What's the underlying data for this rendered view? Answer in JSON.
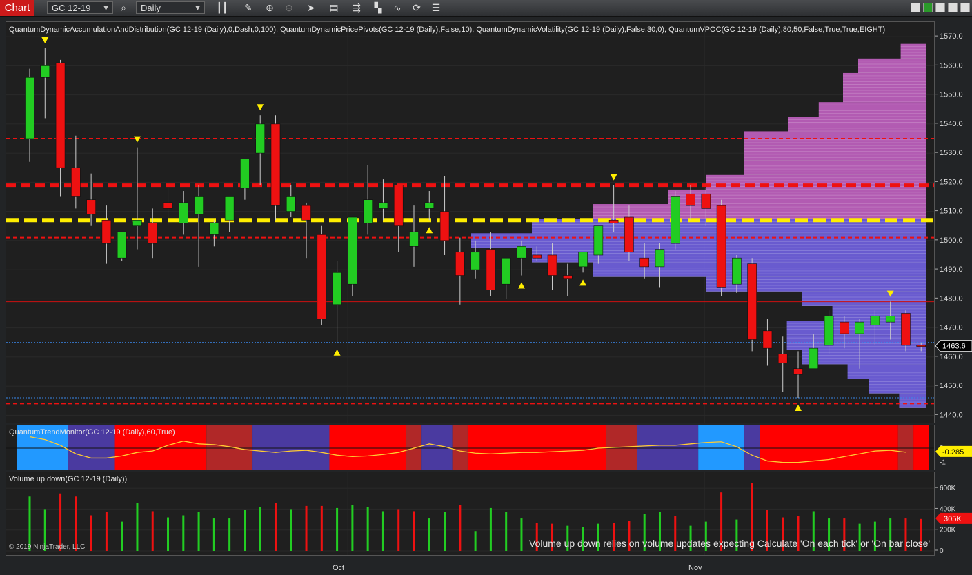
{
  "toolbar": {
    "chart_tab": "Chart",
    "instrument": "GC 12-19",
    "timeframe": "Daily",
    "icons": [
      "search-icon",
      "bars-icon",
      "pencil-icon",
      "zoom-in-icon",
      "zoom-out-icon",
      "pointer-icon",
      "data-box-icon",
      "strategy-icon",
      "drawing-tools-icon",
      "indicators-icon",
      "reload-icon",
      "properties-icon"
    ]
  },
  "price_panel": {
    "indicator_label": "QuantumDynamicAccumulationAndDistribution(GC 12-19 (Daily),0,Dash,0,100), QuantumDynamicPricePivots(GC 12-19 (Daily),False,10), QuantumDynamicVolatility(GC 12-19 (Daily),False,30,0), QuantumVPOC(GC 12-19 (Daily),80,50,False,True,True,EIGHT)",
    "axis_ticks": [
      "1570.0",
      "1560.0",
      "1550.0",
      "1540.0",
      "1530.0",
      "1520.0",
      "1510.0",
      "1500.0",
      "1490.0",
      "1480.0",
      "1470.0",
      "1460.0",
      "1450.0",
      "1440.0"
    ],
    "last_price": "1463.6"
  },
  "trend_panel": {
    "label": "QuantumTrendMonitor(GC 12-19 (Daily),60,True)",
    "axis_ticks": [
      "0",
      "-1"
    ],
    "value": "-0.285"
  },
  "volume_panel": {
    "label": "Volume up down(GC 12-19 (Daily))",
    "axis_ticks": [
      "600K",
      "400K",
      "200K",
      "0"
    ],
    "value": "305K",
    "note": "Volume up down relies on volume updates expecting Calculate 'On each tick' or 'On bar close'",
    "copyright": "© 2019 NinjaTrader, LLC"
  },
  "time_axis": {
    "labels": [
      "Oct",
      "Nov"
    ]
  },
  "colors": {
    "up": "#22cc22",
    "down": "#ee1111",
    "pivot": "#ffee00",
    "vpoc": "#ffee00",
    "volume_profile": "#7766ee",
    "volume_profile_upper": "#cc66cc"
  },
  "chart_data": {
    "type": "candlestick",
    "ylim": [
      1437,
      1575
    ],
    "levels": [
      {
        "price": 1535,
        "style": "dash-red"
      },
      {
        "price": 1519,
        "style": "dash-red-thick"
      },
      {
        "price": 1507,
        "style": "dash-yellow-thick"
      },
      {
        "price": 1501,
        "style": "dash-red"
      },
      {
        "price": 1479,
        "style": "thin-red"
      },
      {
        "price": 1465,
        "style": "thin-blue"
      },
      {
        "price": 1446,
        "style": "thin-blue"
      },
      {
        "price": 1444,
        "style": "dash-red"
      }
    ],
    "candles": [
      {
        "o": 1535,
        "h": 1559,
        "l": 1527,
        "c": 1556
      },
      {
        "o": 1556,
        "h": 1566,
        "l": 1542,
        "c": 1560
      },
      {
        "o": 1561,
        "h": 1562,
        "l": 1515,
        "c": 1525
      },
      {
        "o": 1525,
        "h": 1536,
        "l": 1511,
        "c": 1515
      },
      {
        "o": 1514,
        "h": 1523,
        "l": 1505,
        "c": 1509
      },
      {
        "o": 1507,
        "h": 1512,
        "l": 1492,
        "c": 1499
      },
      {
        "o": 1494,
        "h": 1503,
        "l": 1493,
        "c": 1503
      },
      {
        "o": 1505,
        "h": 1532,
        "l": 1497,
        "c": 1507
      },
      {
        "o": 1506,
        "h": 1511,
        "l": 1494,
        "c": 1499
      },
      {
        "o": 1513,
        "h": 1518,
        "l": 1505,
        "c": 1511
      },
      {
        "o": 1506,
        "h": 1517,
        "l": 1502,
        "c": 1513
      },
      {
        "o": 1509,
        "h": 1519,
        "l": 1491,
        "c": 1515
      },
      {
        "o": 1502,
        "h": 1507,
        "l": 1498,
        "c": 1506
      },
      {
        "o": 1507,
        "h": 1515,
        "l": 1503,
        "c": 1515
      },
      {
        "o": 1518,
        "h": 1521,
        "l": 1514,
        "c": 1528
      },
      {
        "o": 1530,
        "h": 1543,
        "l": 1519,
        "c": 1540
      },
      {
        "o": 1540,
        "h": 1543,
        "l": 1507,
        "c": 1512
      },
      {
        "o": 1510,
        "h": 1519,
        "l": 1508,
        "c": 1515
      },
      {
        "o": 1512,
        "h": 1513,
        "l": 1494,
        "c": 1507
      },
      {
        "o": 1502,
        "h": 1505,
        "l": 1471,
        "c": 1473
      },
      {
        "o": 1478,
        "h": 1493,
        "l": 1465,
        "c": 1489
      },
      {
        "o": 1485,
        "h": 1508,
        "l": 1481,
        "c": 1508
      },
      {
        "o": 1506,
        "h": 1526,
        "l": 1502,
        "c": 1514
      },
      {
        "o": 1511,
        "h": 1521,
        "l": 1507,
        "c": 1513
      },
      {
        "o": 1519,
        "h": 1519,
        "l": 1496,
        "c": 1505
      },
      {
        "o": 1498,
        "h": 1512,
        "l": 1491,
        "c": 1503
      },
      {
        "o": 1511,
        "h": 1517,
        "l": 1507,
        "c": 1513
      },
      {
        "o": 1510,
        "h": 1522,
        "l": 1495,
        "c": 1500
      },
      {
        "o": 1496,
        "h": 1501,
        "l": 1478,
        "c": 1488
      },
      {
        "o": 1490,
        "h": 1500,
        "l": 1487,
        "c": 1496
      },
      {
        "o": 1497,
        "h": 1503,
        "l": 1481,
        "c": 1483
      },
      {
        "o": 1485,
        "h": 1494,
        "l": 1480,
        "c": 1494
      },
      {
        "o": 1494,
        "h": 1500,
        "l": 1488,
        "c": 1498
      },
      {
        "o": 1495,
        "h": 1498,
        "l": 1493,
        "c": 1494
      },
      {
        "o": 1495,
        "h": 1499,
        "l": 1483,
        "c": 1488
      },
      {
        "o": 1488,
        "h": 1492,
        "l": 1481,
        "c": 1487
      },
      {
        "o": 1491,
        "h": 1496,
        "l": 1489,
        "c": 1496
      },
      {
        "o": 1495,
        "h": 1501,
        "l": 1492,
        "c": 1505
      },
      {
        "o": 1507,
        "h": 1519,
        "l": 1503,
        "c": 1506
      },
      {
        "o": 1508,
        "h": 1512,
        "l": 1493,
        "c": 1496
      },
      {
        "o": 1494,
        "h": 1499,
        "l": 1487,
        "c": 1491
      },
      {
        "o": 1491,
        "h": 1499,
        "l": 1484,
        "c": 1497
      },
      {
        "o": 1499,
        "h": 1517,
        "l": 1497,
        "c": 1515
      },
      {
        "o": 1516,
        "h": 1519,
        "l": 1507,
        "c": 1512
      },
      {
        "o": 1516,
        "h": 1518,
        "l": 1505,
        "c": 1511
      },
      {
        "o": 1512,
        "h": 1514,
        "l": 1481,
        "c": 1484
      },
      {
        "o": 1485,
        "h": 1495,
        "l": 1482,
        "c": 1494
      },
      {
        "o": 1492,
        "h": 1494,
        "l": 1462,
        "c": 1466
      },
      {
        "o": 1469,
        "h": 1473,
        "l": 1457,
        "c": 1463
      },
      {
        "o": 1461,
        "h": 1467,
        "l": 1448,
        "c": 1458
      },
      {
        "o": 1456,
        "h": 1462,
        "l": 1446,
        "c": 1454
      },
      {
        "o": 1456,
        "h": 1468,
        "l": 1456,
        "c": 1463
      },
      {
        "o": 1464,
        "h": 1476,
        "l": 1461,
        "c": 1474
      },
      {
        "o": 1472,
        "h": 1474,
        "l": 1463,
        "c": 1468
      },
      {
        "o": 1468,
        "h": 1473,
        "l": 1456,
        "c": 1472
      },
      {
        "o": 1471,
        "h": 1476,
        "l": 1464,
        "c": 1474
      },
      {
        "o": 1472,
        "h": 1479,
        "l": 1466,
        "c": 1474
      },
      {
        "o": 1475,
        "h": 1476,
        "l": 1462,
        "c": 1464
      },
      {
        "o": 1464,
        "h": 1465,
        "l": 1462,
        "c": 1463.6
      }
    ],
    "markers": [
      {
        "i": 1,
        "type": "down"
      },
      {
        "i": 7,
        "type": "down"
      },
      {
        "i": 15,
        "type": "down"
      },
      {
        "i": 20,
        "type": "up"
      },
      {
        "i": 26,
        "type": "up"
      },
      {
        "i": 32,
        "type": "up"
      },
      {
        "i": 36,
        "type": "up"
      },
      {
        "i": 38,
        "type": "down"
      },
      {
        "i": 50,
        "type": "up"
      },
      {
        "i": 56,
        "type": "down"
      }
    ],
    "volume_profile": [
      {
        "price": 1565,
        "size": 0.17
      },
      {
        "price": 1560,
        "size": 0.45
      },
      {
        "price": 1555,
        "size": 0.55
      },
      {
        "price": 1550,
        "size": 0.55
      },
      {
        "price": 1545,
        "size": 0.71
      },
      {
        "price": 1540,
        "size": 0.91
      },
      {
        "price": 1535,
        "size": 1.2
      },
      {
        "price": 1530,
        "size": 1.2
      },
      {
        "price": 1525,
        "size": 1.2
      },
      {
        "price": 1520,
        "size": 1.45
      },
      {
        "price": 1515,
        "size": 1.7
      },
      {
        "price": 1510,
        "size": 2.2
      },
      {
        "price": 1505,
        "size": 2.6
      },
      {
        "price": 1500,
        "size": 3.0
      },
      {
        "price": 1495,
        "size": 2.6
      },
      {
        "price": 1490,
        "size": 2.2
      },
      {
        "price": 1485,
        "size": 1.45
      },
      {
        "price": 1480,
        "size": 0.82
      },
      {
        "price": 1475,
        "size": 0.62
      },
      {
        "price": 1470,
        "size": 0.92
      },
      {
        "price": 1465,
        "size": 0.92
      },
      {
        "price": 1460,
        "size": 0.82
      },
      {
        "price": 1455,
        "size": 0.52
      },
      {
        "price": 1450,
        "size": 0.38
      },
      {
        "price": 1445,
        "size": 0.18
      }
    ],
    "trend_segments": [
      {
        "from": 0,
        "to": 3,
        "color": "#2299ff"
      },
      {
        "from": 3,
        "to": 6,
        "color": "#4a3aa0"
      },
      {
        "from": 6,
        "to": 12,
        "color": "#ff0000"
      },
      {
        "from": 12,
        "to": 15,
        "color": "#b02828"
      },
      {
        "from": 15,
        "to": 20,
        "color": "#4a3aa0"
      },
      {
        "from": 20,
        "to": 25,
        "color": "#ff0000"
      },
      {
        "from": 25,
        "to": 26,
        "color": "#b02828"
      },
      {
        "from": 26,
        "to": 28,
        "color": "#4a3aa0"
      },
      {
        "from": 28,
        "to": 29,
        "color": "#b02828"
      },
      {
        "from": 29,
        "to": 38,
        "color": "#ff0000"
      },
      {
        "from": 38,
        "to": 40,
        "color": "#b02828"
      },
      {
        "from": 40,
        "to": 44,
        "color": "#4a3aa0"
      },
      {
        "from": 44,
        "to": 47,
        "color": "#2299ff"
      },
      {
        "from": 47,
        "to": 48,
        "color": "#4a3aa0"
      },
      {
        "from": 48,
        "to": 57,
        "color": "#ff0000"
      },
      {
        "from": 57,
        "to": 58,
        "color": "#b02828"
      },
      {
        "from": 58,
        "to": 59,
        "color": "#ff0000"
      }
    ],
    "trend_line": [
      0.8,
      0.6,
      0.2,
      -0.4,
      -0.7,
      -0.7,
      -0.55,
      -0.3,
      -0.2,
      0.2,
      0.5,
      0.3,
      0.25,
      0.1,
      -0.1,
      -0.2,
      -0.3,
      -0.2,
      -0.15,
      -0.3,
      -0.5,
      -0.6,
      -0.55,
      -0.45,
      -0.3,
      0.0,
      0.3,
      0.1,
      -0.2,
      -0.35,
      -0.4,
      -0.35,
      -0.3,
      -0.3,
      -0.25,
      -0.2,
      -0.15,
      0.0,
      0.05,
      0.1,
      0.15,
      0.2,
      0.2,
      0.3,
      0.4,
      0.45,
      0.1,
      -0.5,
      -0.9,
      -1.0,
      -1.0,
      -0.9,
      -0.8,
      -0.6,
      -0.4,
      -0.2,
      -0.15,
      -0.285
    ],
    "volume": [
      520,
      400,
      550,
      520,
      340,
      370,
      280,
      460,
      380,
      320,
      340,
      370,
      310,
      310,
      390,
      420,
      460,
      400,
      430,
      430,
      410,
      440,
      420,
      380,
      400,
      380,
      310,
      370,
      440,
      190,
      410,
      370,
      310,
      270,
      260,
      240,
      230,
      260,
      270,
      290,
      350,
      370,
      330,
      240,
      280,
      560,
      300,
      650,
      390,
      320,
      330,
      380,
      310,
      310,
      260,
      280,
      310,
      310,
      305
    ],
    "volume_dir": [
      "up",
      "up",
      "down",
      "down",
      "down",
      "down",
      "up",
      "up",
      "down",
      "up",
      "up",
      "up",
      "up",
      "up",
      "up",
      "up",
      "down",
      "up",
      "down",
      "down",
      "up",
      "up",
      "up",
      "up",
      "down",
      "down",
      "up",
      "up",
      "down",
      "up",
      "up",
      "up",
      "up",
      "down",
      "down",
      "up",
      "up",
      "up",
      "down",
      "down",
      "up",
      "up",
      "down",
      "up",
      "up",
      "down",
      "up",
      "down",
      "down",
      "down",
      "down",
      "up",
      "up",
      "down",
      "up",
      "up",
      "up",
      "down",
      "down"
    ]
  }
}
